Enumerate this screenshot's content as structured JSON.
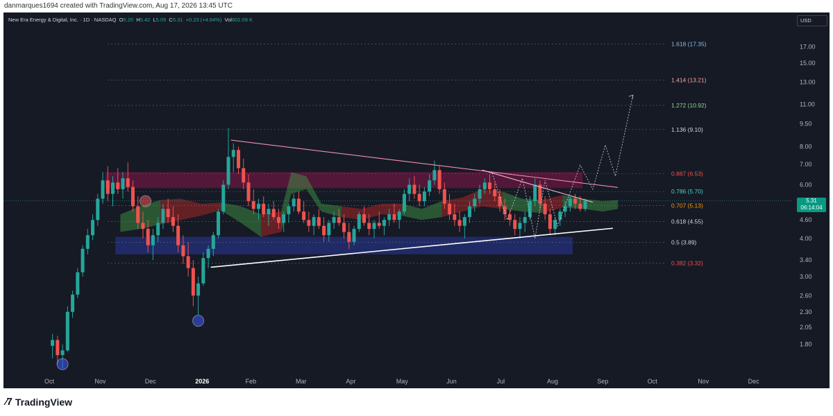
{
  "header": {
    "credit": "danmarques1694 created with TradingView.com, Aug 17, 2026 13:45 UTC"
  },
  "legend": {
    "symbol": "New Era Energy & Digital, Inc. · 1D · NASDAQ",
    "o_label": "O",
    "o_val": "5.20",
    "h_label": "H",
    "h_val": "5.42",
    "l_label": "L",
    "l_val": "5.05",
    "c_label": "C",
    "c_val": "5.31",
    "change": "+0.23 (+4.64%)",
    "vol_label": "Vol",
    "vol_val": "602.09 K"
  },
  "currency": "USD",
  "price_tag": {
    "price": "5.31",
    "countdown": "06:14:04"
  },
  "colors": {
    "background": "#161a25",
    "up": "#26a69a",
    "down": "#ef5350",
    "text": "#b2b5be",
    "fib_1618": "#90b8e0",
    "fib_1414": "#f5a3a8",
    "fib_1272": "#8fd48a",
    "fib_1136": "#d1d4dc",
    "fib_0887": "#ef5350",
    "fib_0786": "#4dd0c1",
    "fib_0707": "#ff9800",
    "fib_0618": "#d1d4dc",
    "fib_05": "#d1d4dc",
    "fib_0382": "#ef5350"
  },
  "footer": {
    "brand": "TradingView",
    "logo_icon": "tradingview-logo-icon"
  },
  "chart_data": {
    "type": "candlestick",
    "title": "New Era Energy & Digital, Inc. · 1D · NASDAQ",
    "y_scale": "log",
    "ylim": [
      1.45,
      22.0
    ],
    "y_ticks": [
      "17.00",
      "15.00",
      "13.00",
      "11.00",
      "9.50",
      "8.00",
      "7.00",
      "6.00",
      "5.31",
      "4.60",
      "4.00",
      "3.40",
      "3.00",
      "2.60",
      "2.30",
      "2.05",
      "1.80"
    ],
    "x_ticks": [
      "Oct",
      "Nov",
      "Dec",
      "2026",
      "Feb",
      "Mar",
      "Apr",
      "May",
      "Jun",
      "Jul",
      "Aug",
      "Sep",
      "Oct",
      "Nov",
      "Dec"
    ],
    "last_price": 5.31,
    "fib_levels": [
      {
        "label": "1.618 (17.35)",
        "value": 17.35,
        "color": "#90b8e0"
      },
      {
        "label": "1.414 (13.21)",
        "value": 13.21,
        "color": "#f5a3a8"
      },
      {
        "label": "1.272 (10.92)",
        "value": 10.92,
        "color": "#8fd48a"
      },
      {
        "label": "1.136 (9.10)",
        "value": 9.1,
        "color": "#d1d4dc"
      },
      {
        "label": "0.887 (6.53)",
        "value": 6.53,
        "color": "#ef5350"
      },
      {
        "label": "0.786 (5.70)",
        "value": 5.7,
        "color": "#4dd0c1"
      },
      {
        "label": "0.707 (5.13)",
        "value": 5.13,
        "color": "#ff9800"
      },
      {
        "label": "0.618 (4.55)",
        "value": 4.55,
        "color": "#d1d4dc"
      },
      {
        "label": "0.5 (3.89)",
        "value": 3.89,
        "color": "#d1d4dc"
      },
      {
        "label": "0.382 (3.32)",
        "value": 3.32,
        "color": "#ef5350"
      }
    ],
    "zones": [
      {
        "name": "resistance-zone",
        "from_month": 1.1,
        "to_month": 10.6,
        "low": 5.85,
        "high": 6.6,
        "color": "#ad1457",
        "opacity": 0.4
      },
      {
        "name": "support-zone",
        "from_month": 1.3,
        "to_month": 10.4,
        "low": 3.55,
        "high": 4.05,
        "color": "#283593",
        "opacity": 0.6
      }
    ],
    "trendlines": [
      {
        "name": "lower-trendline",
        "from": [
          3.2,
          3.22
        ],
        "to": [
          11.2,
          4.32
        ],
        "color": "#ffffff"
      },
      {
        "name": "upper-trendline",
        "from": [
          3.6,
          8.4
        ],
        "to": [
          11.3,
          5.88
        ],
        "color": "#f48fb1"
      },
      {
        "name": "inner-trendline",
        "from": [
          8.6,
          6.7
        ],
        "to": [
          10.8,
          5.26
        ],
        "color": "#f8bbd0"
      }
    ],
    "projection_path": [
      [
        8.8,
        6.55
      ],
      [
        9.1,
        4.6
      ],
      [
        9.4,
        6.3
      ],
      [
        9.65,
        4.0
      ],
      [
        9.85,
        6.2
      ],
      [
        10.1,
        4.4
      ],
      [
        10.55,
        6.95
      ],
      [
        10.8,
        5.8
      ],
      [
        11.05,
        8.1
      ],
      [
        11.25,
        6.4
      ],
      [
        11.6,
        11.8
      ]
    ],
    "circle_markers": [
      {
        "name": "low-marker-oct",
        "month": 0.25,
        "price": 1.55,
        "color": "#3d5afe"
      },
      {
        "name": "low-marker-dec",
        "month": 2.95,
        "price": 2.15,
        "color": "#3d5afe"
      },
      {
        "name": "high-marker-nov",
        "month": 1.9,
        "price": 5.3,
        "color": "#ef5350"
      }
    ],
    "cloud": [
      [
        1.4,
        4.2,
        4.8
      ],
      [
        1.8,
        4.3,
        5.1
      ],
      [
        2.2,
        4.45,
        5.35
      ],
      [
        2.6,
        4.6,
        5.4
      ],
      [
        3.0,
        4.75,
        5.2
      ],
      [
        3.4,
        4.95,
        5.25
      ],
      [
        3.8,
        4.5,
        5.1
      ],
      [
        4.2,
        4.05,
        4.8
      ],
      [
        4.6,
        4.2,
        4.9
      ],
      [
        4.8,
        5.6,
        6.6
      ],
      [
        5.1,
        5.8,
        6.4
      ],
      [
        5.4,
        4.9,
        5.2
      ],
      [
        5.8,
        4.7,
        5.1
      ],
      [
        6.2,
        4.6,
        5.0
      ],
      [
        6.6,
        4.8,
        5.2
      ],
      [
        7.0,
        4.75,
        5.2
      ],
      [
        7.4,
        4.6,
        5.0
      ],
      [
        7.8,
        4.7,
        5.3
      ],
      [
        8.2,
        4.9,
        5.45
      ],
      [
        8.6,
        5.1,
        5.8
      ],
      [
        9.0,
        5.0,
        5.7
      ],
      [
        9.4,
        4.9,
        5.4
      ],
      [
        9.8,
        4.85,
        5.35
      ],
      [
        10.2,
        5.05,
        5.55
      ],
      [
        10.6,
        5.0,
        5.4
      ],
      [
        11.0,
        4.9,
        5.3
      ],
      [
        11.3,
        5.0,
        5.35
      ]
    ],
    "candles": [
      [
        0.05,
        1.78,
        1.95,
        1.62,
        1.86
      ],
      [
        0.15,
        1.86,
        1.92,
        1.55,
        1.66
      ],
      [
        0.25,
        1.66,
        1.8,
        1.5,
        1.72
      ],
      [
        0.35,
        1.72,
        2.4,
        1.7,
        2.3
      ],
      [
        0.45,
        2.3,
        2.7,
        2.2,
        2.62
      ],
      [
        0.55,
        2.62,
        3.2,
        2.55,
        3.1
      ],
      [
        0.65,
        3.1,
        3.8,
        3.0,
        3.7
      ],
      [
        0.75,
        3.7,
        4.3,
        3.55,
        4.1
      ],
      [
        0.85,
        4.1,
        4.8,
        3.95,
        4.6
      ],
      [
        0.95,
        4.6,
        5.6,
        4.4,
        5.4
      ],
      [
        1.05,
        5.4,
        6.6,
        5.2,
        6.2
      ],
      [
        1.15,
        6.2,
        6.9,
        5.3,
        5.6
      ],
      [
        1.25,
        5.6,
        6.4,
        5.1,
        6.1
      ],
      [
        1.35,
        6.1,
        6.8,
        5.6,
        5.8
      ],
      [
        1.45,
        5.8,
        6.6,
        5.4,
        6.3
      ],
      [
        1.55,
        6.3,
        7.1,
        5.7,
        5.9
      ],
      [
        1.65,
        5.9,
        6.2,
        4.9,
        5.1
      ],
      [
        1.75,
        5.1,
        5.5,
        4.3,
        4.5
      ],
      [
        1.85,
        4.5,
        4.9,
        4.0,
        4.3
      ],
      [
        1.95,
        4.3,
        4.6,
        3.6,
        3.8
      ],
      [
        2.05,
        3.8,
        4.3,
        3.4,
        4.1
      ],
      [
        2.15,
        4.1,
        4.7,
        3.9,
        4.5
      ],
      [
        2.25,
        4.5,
        5.2,
        4.3,
        5.0
      ],
      [
        2.35,
        5.0,
        5.4,
        4.5,
        4.7
      ],
      [
        2.45,
        4.7,
        5.1,
        4.2,
        4.4
      ],
      [
        2.55,
        4.4,
        4.8,
        3.6,
        3.8
      ],
      [
        2.65,
        3.8,
        4.1,
        3.3,
        3.5
      ],
      [
        2.75,
        3.5,
        3.9,
        3.0,
        3.2
      ],
      [
        2.85,
        3.2,
        3.4,
        2.4,
        2.6
      ],
      [
        2.95,
        2.6,
        3.0,
        2.25,
        2.85
      ],
      [
        3.05,
        2.85,
        3.6,
        2.8,
        3.45
      ],
      [
        3.15,
        3.45,
        3.8,
        3.2,
        3.7
      ],
      [
        3.25,
        3.7,
        4.2,
        3.5,
        4.1
      ],
      [
        3.35,
        4.1,
        5.0,
        4.0,
        4.9
      ],
      [
        3.45,
        4.9,
        6.2,
        4.8,
        6.0
      ],
      [
        3.55,
        6.0,
        9.2,
        5.8,
        7.4
      ],
      [
        3.65,
        7.4,
        8.2,
        6.6,
        7.8
      ],
      [
        3.75,
        7.8,
        8.0,
        6.5,
        6.8
      ],
      [
        3.85,
        6.8,
        7.3,
        5.8,
        6.1
      ],
      [
        3.95,
        6.1,
        6.5,
        5.1,
        5.3
      ],
      [
        4.05,
        5.3,
        5.8,
        4.8,
        5.0
      ],
      [
        4.15,
        5.0,
        5.4,
        4.6,
        5.2
      ],
      [
        4.25,
        5.2,
        5.5,
        4.7,
        4.8
      ],
      [
        4.35,
        4.8,
        5.2,
        4.4,
        5.0
      ],
      [
        4.45,
        5.0,
        5.3,
        4.6,
        4.7
      ],
      [
        4.55,
        4.7,
        5.0,
        4.3,
        4.5
      ],
      [
        4.65,
        4.5,
        4.9,
        4.2,
        4.8
      ],
      [
        4.75,
        4.8,
        5.2,
        4.5,
        5.1
      ],
      [
        4.85,
        5.1,
        5.6,
        4.9,
        5.4
      ],
      [
        4.95,
        5.4,
        5.7,
        4.8,
        4.9
      ],
      [
        5.05,
        4.9,
        5.3,
        4.5,
        4.6
      ],
      [
        5.15,
        4.6,
        4.9,
        4.2,
        4.4
      ],
      [
        5.25,
        4.4,
        4.8,
        4.1,
        4.7
      ],
      [
        5.35,
        4.7,
        5.0,
        4.3,
        4.4
      ],
      [
        5.45,
        4.4,
        4.7,
        3.9,
        4.1
      ],
      [
        5.55,
        4.1,
        4.6,
        3.9,
        4.5
      ],
      [
        5.65,
        4.5,
        4.9,
        4.3,
        4.7
      ],
      [
        5.75,
        4.7,
        5.0,
        4.4,
        4.5
      ],
      [
        5.85,
        4.5,
        4.8,
        4.0,
        4.2
      ],
      [
        5.95,
        4.2,
        4.5,
        3.7,
        3.9
      ],
      [
        6.05,
        3.9,
        4.4,
        3.8,
        4.3
      ],
      [
        6.15,
        4.3,
        4.9,
        4.2,
        4.8
      ],
      [
        6.25,
        4.8,
        5.1,
        4.4,
        4.5
      ],
      [
        6.35,
        4.5,
        4.8,
        4.1,
        4.3
      ],
      [
        6.45,
        4.3,
        4.6,
        4.0,
        4.5
      ],
      [
        6.55,
        4.5,
        4.9,
        4.3,
        4.4
      ],
      [
        6.65,
        4.4,
        4.7,
        4.1,
        4.6
      ],
      [
        6.75,
        4.6,
        5.0,
        4.4,
        4.8
      ],
      [
        6.85,
        4.8,
        5.2,
        4.5,
        4.6
      ],
      [
        6.95,
        4.6,
        5.0,
        4.3,
        4.9
      ],
      [
        7.05,
        4.9,
        5.8,
        4.8,
        5.6
      ],
      [
        7.15,
        5.6,
        6.3,
        5.3,
        6.0
      ],
      [
        7.25,
        6.0,
        6.4,
        5.4,
        5.6
      ],
      [
        7.35,
        5.6,
        6.0,
        5.1,
        5.3
      ],
      [
        7.45,
        5.3,
        5.9,
        5.1,
        5.7
      ],
      [
        7.55,
        5.7,
        6.5,
        5.5,
        6.2
      ],
      [
        7.65,
        6.2,
        7.2,
        6.0,
        6.7
      ],
      [
        7.75,
        6.7,
        6.9,
        5.6,
        5.8
      ],
      [
        7.85,
        5.8,
        6.1,
        5.0,
        5.2
      ],
      [
        7.95,
        5.2,
        5.6,
        4.6,
        4.8
      ],
      [
        8.05,
        4.8,
        5.2,
        4.4,
        4.6
      ],
      [
        8.15,
        4.6,
        4.9,
        4.2,
        4.4
      ],
      [
        8.25,
        4.4,
        4.8,
        4.0,
        4.7
      ],
      [
        8.35,
        4.7,
        5.3,
        4.5,
        5.1
      ],
      [
        8.45,
        5.1,
        5.6,
        4.9,
        5.4
      ],
      [
        8.55,
        5.4,
        6.0,
        5.2,
        5.8
      ],
      [
        8.65,
        5.8,
        6.3,
        5.6,
        6.1
      ],
      [
        8.75,
        6.1,
        6.5,
        5.6,
        5.8
      ],
      [
        8.85,
        5.8,
        6.1,
        5.3,
        5.5
      ],
      [
        8.95,
        5.5,
        5.8,
        4.9,
        5.1
      ],
      [
        9.05,
        5.1,
        5.4,
        4.6,
        4.8
      ],
      [
        9.15,
        4.8,
        5.0,
        4.4,
        4.6
      ],
      [
        9.25,
        4.6,
        4.8,
        4.1,
        4.3
      ],
      [
        9.35,
        4.3,
        4.7,
        4.0,
        4.5
      ],
      [
        9.45,
        4.5,
        4.9,
        4.2,
        4.7
      ],
      [
        9.55,
        4.7,
        5.5,
        4.6,
        5.3
      ],
      [
        9.65,
        5.3,
        6.3,
        5.1,
        6.0
      ],
      [
        9.75,
        6.0,
        6.2,
        5.0,
        5.2
      ],
      [
        9.85,
        5.2,
        5.5,
        4.6,
        4.8
      ],
      [
        9.95,
        4.8,
        5.0,
        4.1,
        4.3
      ],
      [
        10.05,
        4.3,
        4.7,
        4.1,
        4.6
      ],
      [
        10.15,
        4.6,
        5.0,
        4.4,
        4.9
      ],
      [
        10.25,
        4.9,
        5.3,
        4.7,
        5.1
      ],
      [
        10.35,
        5.1,
        5.5,
        4.9,
        5.4
      ],
      [
        10.45,
        5.4,
        5.6,
        5.0,
        5.2
      ],
      [
        10.55,
        5.2,
        5.5,
        4.9,
        5.0
      ],
      [
        10.65,
        5.0,
        5.4,
        4.9,
        5.31
      ]
    ]
  }
}
